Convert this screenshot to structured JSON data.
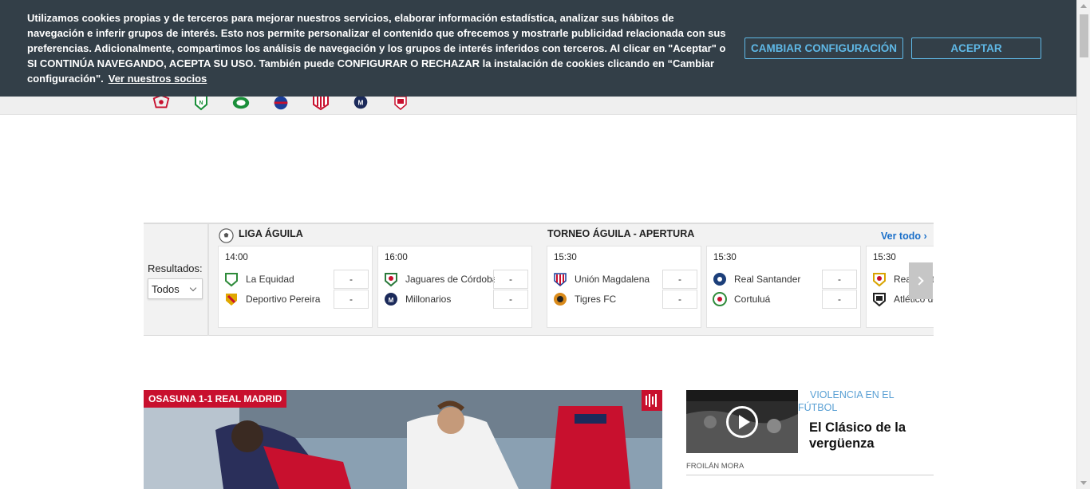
{
  "cookie_banner": {
    "text": "Utilizamos cookies propias y de terceros para mejorar nuestros servicios, elaborar información estadística, analizar sus hábitos de navegación e inferir grupos de interés. Esto nos permite personalizar el contenido que ofrecemos y mostrarle publicidad relacionada con sus preferencias. Adicionalmente, compartimos los análisis de navegación y los grupos de interés inferidos con terceros. Al clicar en \"Aceptar\" o SI CONTINÚA NAVEGANDO, ACEPTA SU USO. También puede CONFIGURAR O RECHAZAR la instalación de cookies clicando en “Cambiar configuración\".",
    "partners_link": "Ver nuestros socios",
    "config_button": "CAMBIAR CONFIGURACIÓN",
    "accept_button": "ACEPTAR"
  },
  "team_strip": {
    "logos": [
      "america-cali-crest",
      "nacional-crest",
      "deportivo-cali-crest",
      "medellin-crest",
      "junior-crest",
      "millonarios-crest",
      "santa-fe-crest"
    ]
  },
  "results": {
    "label": "Resultados:",
    "filter_value": "Todos",
    "leagues": [
      {
        "name": "LIGA ÁGUILA"
      },
      {
        "name": "TORNEO ÁGUILA - APERTURA"
      }
    ],
    "see_all": "Ver todo",
    "matches": [
      {
        "time": "14:00",
        "home": "La Equidad",
        "away": "Deportivo Pereira",
        "home_score": "-",
        "away_score": "-",
        "home_color": "#2e8b3a",
        "away_color": "#e0a800"
      },
      {
        "time": "16:00",
        "home": "Jaguares de Córdoba",
        "away": "Millonarios",
        "home_score": "-",
        "away_score": "-",
        "home_color": "#2a7a3b",
        "away_color": "#1b2a5a"
      },
      {
        "time": "15:30",
        "home": "Unión Magdalena",
        "away": "Tigres FC",
        "home_score": "-",
        "away_score": "-",
        "home_color": "#c8102e",
        "away_color": "#d98a1a"
      },
      {
        "time": "15:30",
        "home": "Real Santander",
        "away": "Cortuluá",
        "home_score": "-",
        "away_score": "-",
        "home_color": "#1c3f7a",
        "away_color": "#2e8b3a"
      },
      {
        "time": "15:30",
        "home": "Real Cartagena",
        "away": "Atlético de Cali",
        "home_score": "-",
        "away_score": "-",
        "home_color": "#d9a400",
        "away_color": "#222222"
      }
    ]
  },
  "hero": {
    "tag": "OSASUNA 1-1 REAL MADRID"
  },
  "side_news": {
    "category": "VIOLENCIA EN EL FÚTBOL",
    "title": "El Clásico de la vergüenza",
    "author": "FROILÁN MORA"
  },
  "colors": {
    "banner_bg": "#333f48",
    "banner_accent": "#5fb8e6",
    "brand_red": "#c8102e",
    "link_blue": "#1a6fc9"
  }
}
